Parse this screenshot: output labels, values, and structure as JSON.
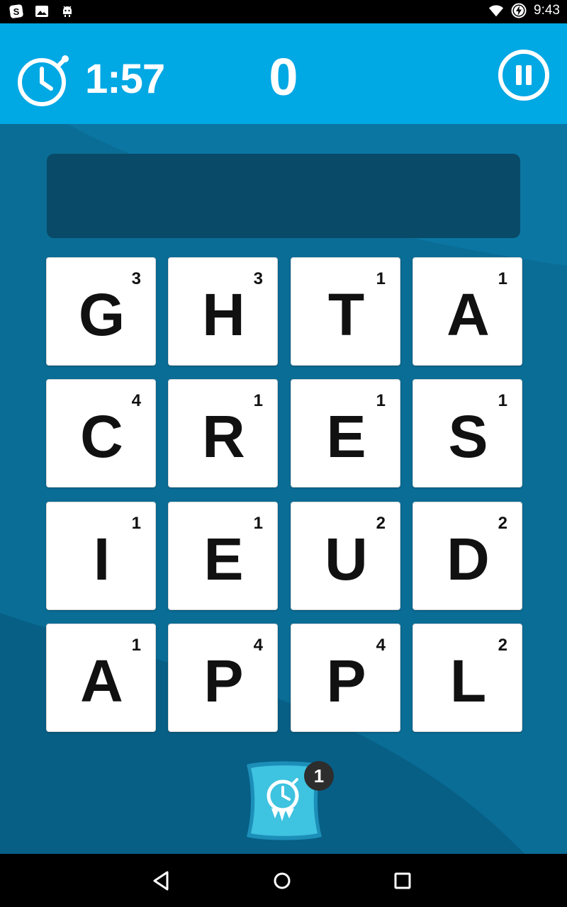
{
  "status_bar": {
    "time": "9:43",
    "left_icons": [
      "s-app-icon",
      "image-icon",
      "android-debug-icon"
    ],
    "right_icons": [
      "wifi-icon",
      "battery-charging-icon"
    ]
  },
  "header": {
    "timer": "1:57",
    "score": "0"
  },
  "word_display": {
    "current_word": ""
  },
  "board": {
    "rows": [
      [
        {
          "letter": "G",
          "points": "3"
        },
        {
          "letter": "H",
          "points": "3"
        },
        {
          "letter": "T",
          "points": "1"
        },
        {
          "letter": "A",
          "points": "1"
        }
      ],
      [
        {
          "letter": "C",
          "points": "4"
        },
        {
          "letter": "R",
          "points": "1"
        },
        {
          "letter": "E",
          "points": "1"
        },
        {
          "letter": "S",
          "points": "1"
        }
      ],
      [
        {
          "letter": "I",
          "points": "1"
        },
        {
          "letter": "E",
          "points": "1"
        },
        {
          "letter": "U",
          "points": "2"
        },
        {
          "letter": "D",
          "points": "2"
        }
      ],
      [
        {
          "letter": "A",
          "points": "1"
        },
        {
          "letter": "P",
          "points": "4"
        },
        {
          "letter": "P",
          "points": "4"
        },
        {
          "letter": "L",
          "points": "2"
        }
      ]
    ]
  },
  "powerup": {
    "icon": "freeze-timer-icon",
    "count": "1"
  },
  "colors": {
    "header_bg": "#00a8e4",
    "game_bg": "#0a6d96",
    "word_display_bg": "#094a68",
    "powerup_bg": "#3ec3e0"
  }
}
